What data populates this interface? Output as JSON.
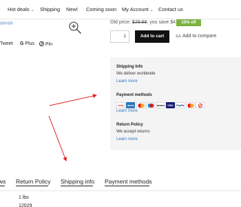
{
  "nav": {
    "items": [
      "Hot deals",
      "Shipping",
      "New!",
      "Coming soon",
      "My Account",
      "Contact us"
    ]
  },
  "product": {
    "price_left_fragment": "29.99",
    "old_price_label": "Old price:",
    "old_price": "$29.99",
    "save_text": ", you save $4.50",
    "off_badge": "15% off",
    "quantity": "1",
    "add_to_cart": "Add to cart",
    "add_to_compare": "Add to compare"
  },
  "share": {
    "tweet": "Tweet",
    "gplus_letter": "G",
    "gplus": "Plus",
    "pin": "Pin"
  },
  "info": {
    "shipping_title": "Shipping Info",
    "shipping_text": "We deliver worldwide",
    "learn_more_1": "Learn more",
    "payment_title": "Payment methods",
    "learn_more_2": "Learn more",
    "return_title": "Return Policy",
    "return_text": "We accept returns",
    "learn_more_3": "Learn more",
    "payment_icons": [
      "ebay",
      "amex",
      "mc",
      "maestro",
      "amazon",
      "VISA",
      "PayPal",
      "mc",
      "card"
    ]
  },
  "tabs": {
    "reviews_fragment": "ws",
    "return_policy": "Return Policy",
    "shipping_info": "Shipping info",
    "payment_methods": "Payment methods"
  },
  "specs": {
    "weight": "1 lbs",
    "sku_fragment": "12029"
  },
  "colors": {
    "accent_link": "#2a73c5",
    "badge_green": "#7cb342",
    "arrow_red": "#e02020",
    "button_black": "#111111"
  }
}
